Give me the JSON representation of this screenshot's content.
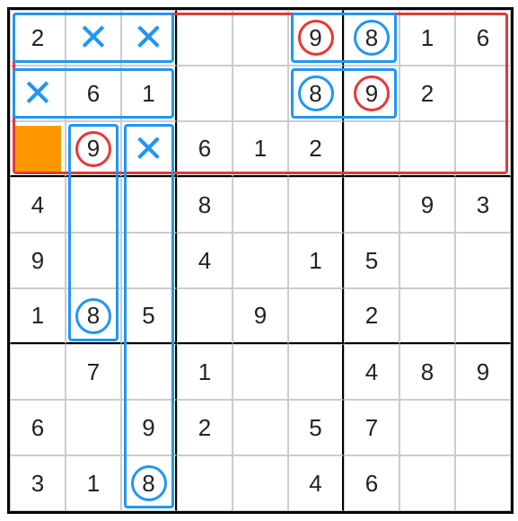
{
  "grid": [
    [
      "2",
      "",
      "",
      "",
      "",
      "9",
      "8",
      "1",
      "6"
    ],
    [
      "",
      "6",
      "1",
      "",
      "",
      "8",
      "9",
      "2",
      ""
    ],
    [
      "",
      "9",
      "",
      "6",
      "1",
      "2",
      "",
      "",
      ""
    ],
    [
      "4",
      "",
      "",
      "8",
      "",
      "",
      "",
      "9",
      "3"
    ],
    [
      "9",
      "",
      "",
      "4",
      "",
      "1",
      "5",
      "",
      ""
    ],
    [
      "1",
      "8",
      "5",
      "",
      "9",
      "",
      "2",
      "",
      ""
    ],
    [
      "",
      "7",
      "",
      "1",
      "",
      "",
      "4",
      "8",
      "9"
    ],
    [
      "6",
      "",
      "9",
      "2",
      "",
      "5",
      "7",
      "",
      ""
    ],
    [
      "3",
      "1",
      "8",
      "",
      "",
      "4",
      "6",
      "",
      ""
    ]
  ],
  "x_marks": [
    {
      "r": 0,
      "c": 1
    },
    {
      "r": 0,
      "c": 2
    },
    {
      "r": 1,
      "c": 0
    },
    {
      "r": 2,
      "c": 2
    }
  ],
  "circles": [
    {
      "r": 0,
      "c": 5,
      "color": "red"
    },
    {
      "r": 0,
      "c": 6,
      "color": "blue"
    },
    {
      "r": 1,
      "c": 5,
      "color": "blue"
    },
    {
      "r": 1,
      "c": 6,
      "color": "red"
    },
    {
      "r": 2,
      "c": 1,
      "color": "red"
    },
    {
      "r": 5,
      "c": 1,
      "color": "blue"
    },
    {
      "r": 8,
      "c": 2,
      "color": "blue"
    }
  ],
  "highlight": {
    "r": 2,
    "c": 0,
    "color": "orange"
  },
  "overlays": [
    {
      "type": "row-band",
      "r0": 0,
      "r1": 2,
      "c0": 0,
      "c1": 8,
      "color": "red"
    },
    {
      "type": "cells",
      "r0": 0,
      "r1": 0,
      "c0": 0,
      "c1": 2,
      "color": "blue"
    },
    {
      "type": "cells",
      "r0": 0,
      "r1": 0,
      "c0": 5,
      "c1": 6,
      "color": "blue"
    },
    {
      "type": "cells",
      "r0": 1,
      "r1": 1,
      "c0": 0,
      "c1": 2,
      "color": "blue"
    },
    {
      "type": "cells",
      "r0": 1,
      "r1": 1,
      "c0": 5,
      "c1": 6,
      "color": "blue"
    },
    {
      "type": "col",
      "r0": 2,
      "r1": 5,
      "c0": 1,
      "c1": 1,
      "color": "blue"
    },
    {
      "type": "col",
      "r0": 2,
      "r1": 8,
      "c0": 2,
      "c1": 2,
      "color": "blue"
    }
  ],
  "cell_size": 62
}
